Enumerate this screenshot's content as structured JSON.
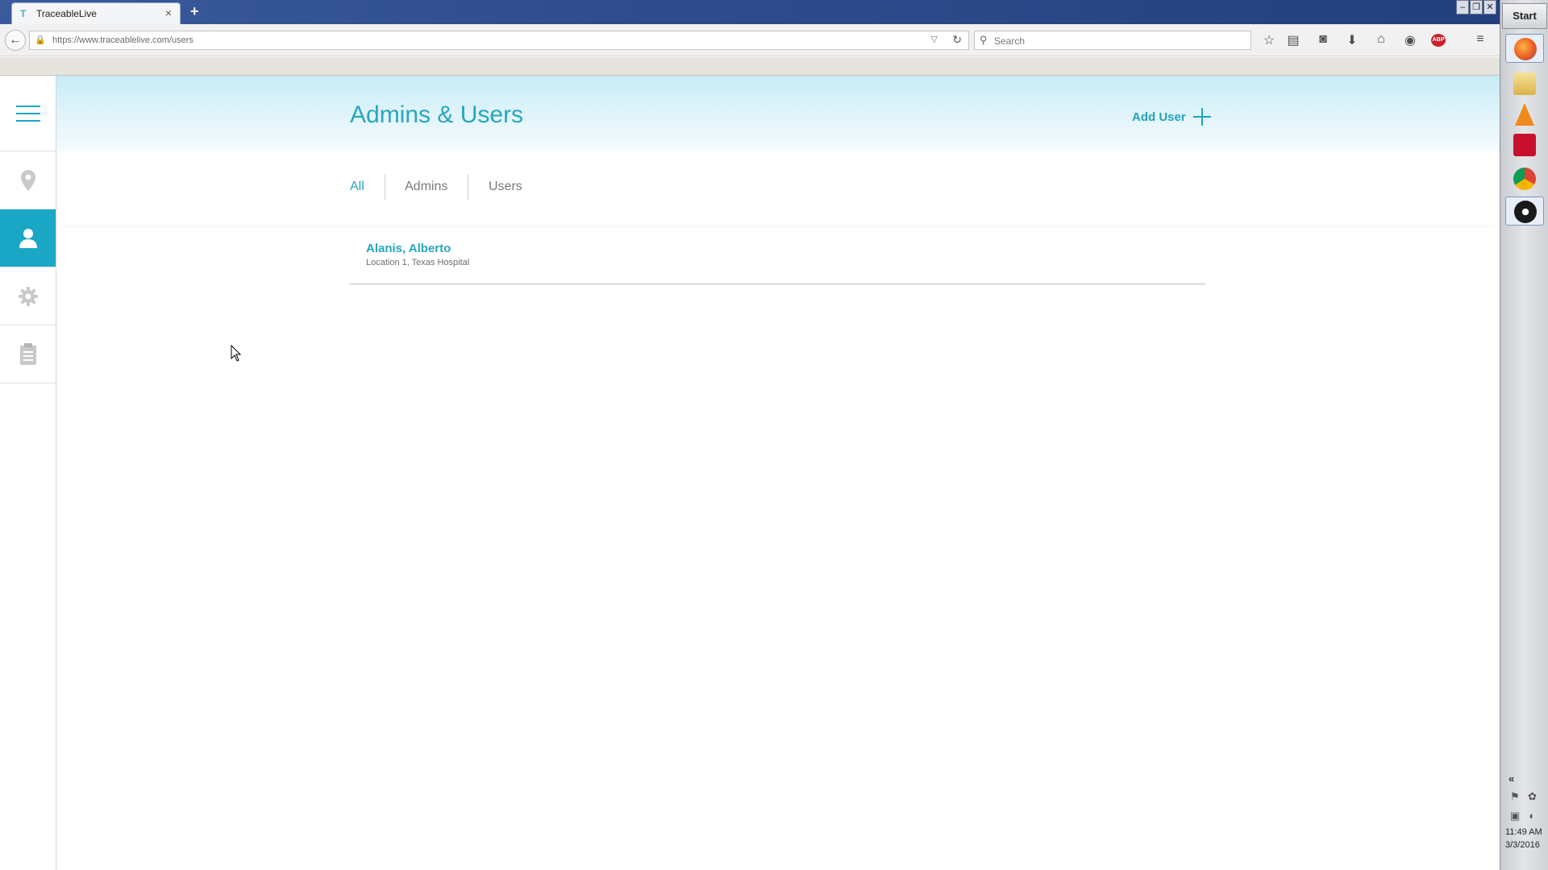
{
  "browser": {
    "tab_title": "TraceableLive",
    "tab_close": "×",
    "new_tab": "+",
    "url": "https://www.traceablelive.com/users",
    "search_placeholder": "Search"
  },
  "app": {
    "title": "Admins & Users",
    "add_user_label": "Add User",
    "filters": [
      {
        "label": "All",
        "active": true
      },
      {
        "label": "Admins",
        "active": false
      },
      {
        "label": "Users",
        "active": false
      }
    ],
    "users": [
      {
        "name": "Alanis, Alberto",
        "subtitle": "Location 1, Texas Hospital"
      }
    ],
    "accent_color": "#27a6c0",
    "sidebar_active_color": "#1aa7c5",
    "sidebar": [
      {
        "icon": "hamburger-menu-icon"
      },
      {
        "icon": "location-pin-icon"
      },
      {
        "icon": "user-icon",
        "active": true
      },
      {
        "icon": "gear-icon"
      },
      {
        "icon": "clipboard-icon"
      }
    ]
  },
  "taskbar": {
    "start_label": "Start",
    "time": "11:49 AM",
    "date": "3/3/2016",
    "tray_expand": "«"
  }
}
